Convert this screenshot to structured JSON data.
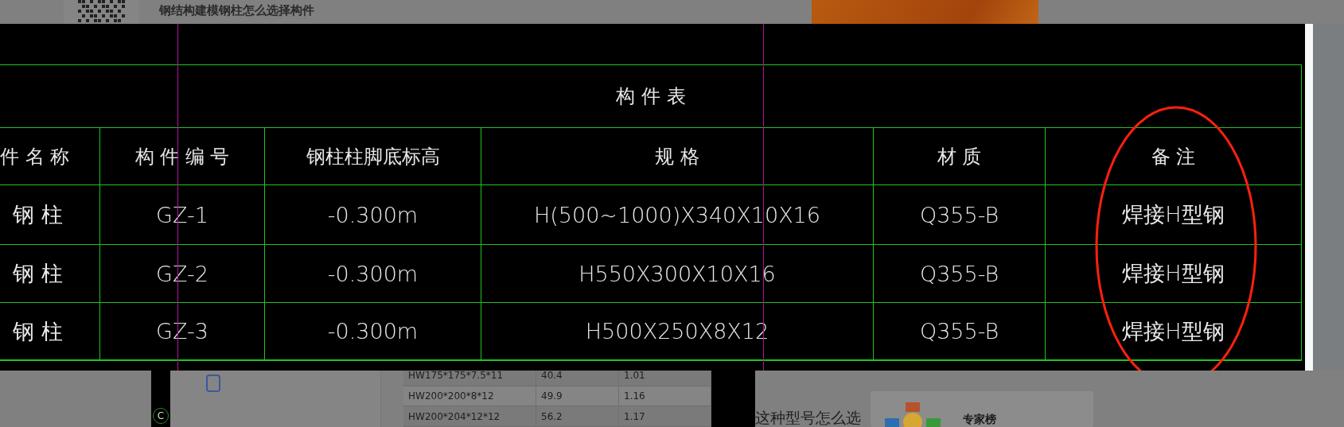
{
  "page_title": "钢结构建模钢柱怎么选择构件",
  "cad_table": {
    "title": "构 件 表",
    "columns": [
      "件 名 称",
      "构 件 编 号",
      "钢柱柱脚底标高",
      "规 格",
      "材 质",
      "备 注"
    ],
    "rows": [
      [
        "钢 柱",
        "GZ-1",
        "-0.300m",
        "H(500~1000)X340X10X16",
        "Q355-B",
        "焊接H型钢"
      ],
      [
        "钢 柱",
        "GZ-2",
        "-0.300m",
        "H550X300X10X16",
        "Q355-B",
        "焊接H型钢"
      ],
      [
        "钢 柱",
        "GZ-3",
        "-0.300m",
        "H500X250X8X12",
        "Q355-B",
        "焊接H型钢"
      ]
    ]
  },
  "thumbnail_marker": "C",
  "section_table": {
    "rows": [
      [
        "HW175*175*7.5*11",
        "40.4",
        "1.01"
      ],
      [
        "HW200*200*8*12",
        "49.9",
        "1.16"
      ],
      [
        "HW200*204*12*12",
        "56.2",
        "1.17"
      ]
    ]
  },
  "question_text": "这种型号怎么选",
  "expert_card": {
    "title": "专家榜"
  }
}
